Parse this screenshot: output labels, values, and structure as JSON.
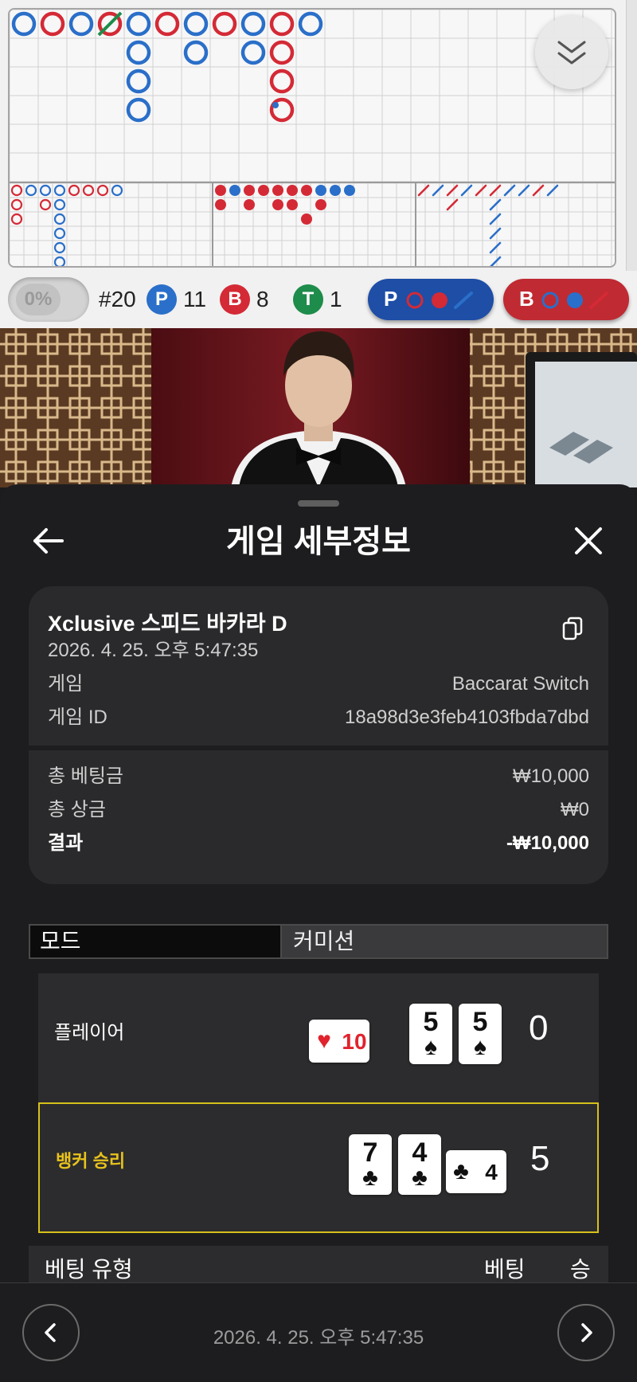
{
  "roadmap": {
    "colors": {
      "player": "#2a6fc9",
      "banker": "#d42a36",
      "tie": "#1e8c4a",
      "grid": "#d0d0d0"
    },
    "big_road": [
      {
        "col": 0,
        "row": 0,
        "r": "P"
      },
      {
        "col": 1,
        "row": 0,
        "r": "B"
      },
      {
        "col": 2,
        "row": 0,
        "r": "P"
      },
      {
        "col": 3,
        "row": 0,
        "r": "B",
        "tie": true
      },
      {
        "col": 4,
        "row": 0,
        "r": "P"
      },
      {
        "col": 4,
        "row": 1,
        "r": "P"
      },
      {
        "col": 4,
        "row": 2,
        "r": "P"
      },
      {
        "col": 4,
        "row": 3,
        "r": "P"
      },
      {
        "col": 5,
        "row": 0,
        "r": "B"
      },
      {
        "col": 6,
        "row": 0,
        "r": "P"
      },
      {
        "col": 6,
        "row": 1,
        "r": "P"
      },
      {
        "col": 7,
        "row": 0,
        "r": "B"
      },
      {
        "col": 8,
        "row": 0,
        "r": "P"
      },
      {
        "col": 8,
        "row": 1,
        "r": "P"
      },
      {
        "col": 9,
        "row": 0,
        "r": "B"
      },
      {
        "col": 9,
        "row": 1,
        "r": "B"
      },
      {
        "col": 9,
        "row": 2,
        "r": "B"
      },
      {
        "col": 9,
        "row": 3,
        "r": "B",
        "pair": true
      },
      {
        "col": 10,
        "row": 0,
        "r": "P"
      }
    ],
    "big_eye": [
      {
        "col": 0,
        "row": 0,
        "r": "B"
      },
      {
        "col": 1,
        "row": 0,
        "r": "P"
      },
      {
        "col": 2,
        "row": 0,
        "r": "P"
      },
      {
        "col": 3,
        "row": 0,
        "r": "P"
      },
      {
        "col": 4,
        "row": 0,
        "r": "B"
      },
      {
        "col": 5,
        "row": 0,
        "r": "B"
      },
      {
        "col": 6,
        "row": 0,
        "r": "B"
      },
      {
        "col": 7,
        "row": 0,
        "r": "P"
      },
      {
        "col": 0,
        "row": 1,
        "r": "B"
      },
      {
        "col": 0,
        "row": 2,
        "r": "B"
      },
      {
        "col": 2,
        "row": 1,
        "r": "B"
      },
      {
        "col": 3,
        "row": 1,
        "r": "P"
      },
      {
        "col": 3,
        "row": 2,
        "r": "P"
      },
      {
        "col": 3,
        "row": 3,
        "r": "P"
      },
      {
        "col": 3,
        "row": 4,
        "r": "P"
      },
      {
        "col": 3,
        "row": 5,
        "r": "P"
      },
      {
        "col": 3,
        "row": 6,
        "r": "P"
      },
      {
        "col": 4,
        "row": 6,
        "r": "P"
      }
    ],
    "small_road": [
      {
        "col": 0,
        "row": 0,
        "r": "B"
      },
      {
        "col": 1,
        "row": 0,
        "r": "P"
      },
      {
        "col": 2,
        "row": 0,
        "r": "B"
      },
      {
        "col": 3,
        "row": 0,
        "r": "B"
      },
      {
        "col": 4,
        "row": 0,
        "r": "B"
      },
      {
        "col": 5,
        "row": 0,
        "r": "B"
      },
      {
        "col": 6,
        "row": 0,
        "r": "B"
      },
      {
        "col": 7,
        "row": 0,
        "r": "P"
      },
      {
        "col": 8,
        "row": 0,
        "r": "P"
      },
      {
        "col": 9,
        "row": 0,
        "r": "P"
      },
      {
        "col": 0,
        "row": 1,
        "r": "B"
      },
      {
        "col": 2,
        "row": 1,
        "r": "B"
      },
      {
        "col": 4,
        "row": 1,
        "r": "B"
      },
      {
        "col": 5,
        "row": 1,
        "r": "B"
      },
      {
        "col": 7,
        "row": 1,
        "r": "B"
      },
      {
        "col": 6,
        "row": 2,
        "r": "B"
      }
    ],
    "cockroach": [
      {
        "col": 0,
        "row": 0,
        "r": "B"
      },
      {
        "col": 1,
        "row": 0,
        "r": "P"
      },
      {
        "col": 2,
        "row": 0,
        "r": "B"
      },
      {
        "col": 3,
        "row": 0,
        "r": "P"
      },
      {
        "col": 4,
        "row": 0,
        "r": "B"
      },
      {
        "col": 5,
        "row": 0,
        "r": "B"
      },
      {
        "col": 6,
        "row": 0,
        "r": "P"
      },
      {
        "col": 7,
        "row": 0,
        "r": "P"
      },
      {
        "col": 8,
        "row": 0,
        "r": "B"
      },
      {
        "col": 9,
        "row": 0,
        "r": "P"
      },
      {
        "col": 2,
        "row": 1,
        "r": "B"
      },
      {
        "col": 5,
        "row": 1,
        "r": "P"
      },
      {
        "col": 5,
        "row": 2,
        "r": "P"
      },
      {
        "col": 5,
        "row": 3,
        "r": "P"
      },
      {
        "col": 5,
        "row": 4,
        "r": "P"
      },
      {
        "col": 5,
        "row": 5,
        "r": "P"
      }
    ],
    "collapse_icon": "double-chevron-down-icon"
  },
  "stats": {
    "percent": "0%",
    "round": "#20",
    "player_letter": "P",
    "player_count": "11",
    "banker_letter": "B",
    "banker_count": "8",
    "tie_letter": "T",
    "tie_count": "1",
    "player_predict": "P",
    "banker_predict": "B"
  },
  "panel": {
    "title": "게임 세부정보",
    "game_name": "Xclusive 스피드 바카라 D",
    "datetime": "2026. 4. 25. 오후 5:47:35",
    "rows": [
      {
        "label": "게임",
        "value": "Baccarat Switch"
      },
      {
        "label": "게임 ID",
        "value": "18a98d3e3feb4103fbda7dbd"
      }
    ],
    "totals": [
      {
        "label": "총 베팅금",
        "value": "₩10,000"
      },
      {
        "label": "총 상금",
        "value": "₩0"
      }
    ],
    "result_label": "결과",
    "result_value": "-₩10,000",
    "tabs": {
      "mode": "모드",
      "commission": "커미션"
    },
    "player": {
      "name": "플레이어",
      "score": "0",
      "cards": [
        {
          "rank": "10",
          "suit": "♥",
          "color": "red",
          "sideways": true
        },
        {
          "rank": "5",
          "suit": "♠",
          "color": "black",
          "sideways": false
        },
        {
          "rank": "5",
          "suit": "♠",
          "color": "black",
          "sideways": false
        }
      ]
    },
    "banker": {
      "name": "뱅커 승리",
      "score": "5",
      "cards": [
        {
          "rank": "7",
          "suit": "♣",
          "color": "black",
          "sideways": false
        },
        {
          "rank": "4",
          "suit": "♣",
          "color": "black",
          "sideways": false
        },
        {
          "rank": "4",
          "suit": "♣",
          "color": "black",
          "sideways": true
        }
      ]
    },
    "bet_table": {
      "type": "베팅 유형",
      "bet": "베팅",
      "win": "승"
    },
    "footer_datetime": "2026. 4. 25. 오후 5:47:35"
  }
}
